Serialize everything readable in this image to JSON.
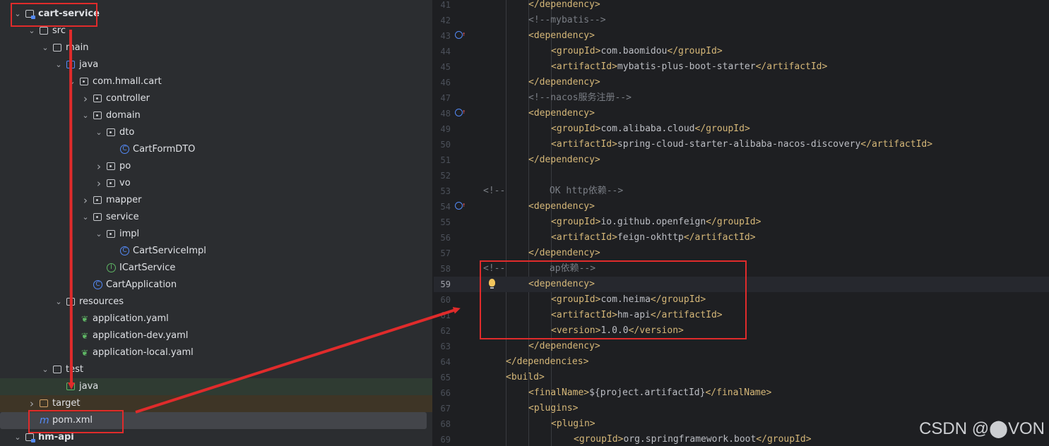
{
  "tree": {
    "items": [
      {
        "label": "cart-service",
        "type": "module",
        "expanded": true
      },
      {
        "label": "src",
        "type": "folder",
        "expanded": true
      },
      {
        "label": "main",
        "type": "folder",
        "expanded": true
      },
      {
        "label": "java",
        "type": "source-root",
        "expanded": true
      },
      {
        "label": "com.hmall.cart",
        "type": "package",
        "expanded": true
      },
      {
        "label": "controller",
        "type": "package",
        "expanded": false
      },
      {
        "label": "domain",
        "type": "package",
        "expanded": true
      },
      {
        "label": "dto",
        "type": "package",
        "expanded": true
      },
      {
        "label": "CartFormDTO",
        "type": "class"
      },
      {
        "label": "po",
        "type": "package",
        "expanded": false
      },
      {
        "label": "vo",
        "type": "package",
        "expanded": false
      },
      {
        "label": "mapper",
        "type": "package",
        "expanded": false
      },
      {
        "label": "service",
        "type": "package",
        "expanded": true
      },
      {
        "label": "impl",
        "type": "package",
        "expanded": true
      },
      {
        "label": "CartServiceImpl",
        "type": "class"
      },
      {
        "label": "ICartService",
        "type": "interface"
      },
      {
        "label": "CartApplication",
        "type": "spring-class"
      },
      {
        "label": "resources",
        "type": "resources-root",
        "expanded": true
      },
      {
        "label": "application.yaml",
        "type": "yaml"
      },
      {
        "label": "application-dev.yaml",
        "type": "yaml"
      },
      {
        "label": "application-local.yaml",
        "type": "yaml"
      },
      {
        "label": "test",
        "type": "folder",
        "expanded": true
      },
      {
        "label": "java",
        "type": "test-root"
      },
      {
        "label": "target",
        "type": "excluded",
        "expanded": false
      },
      {
        "label": "pom.xml",
        "type": "maven"
      },
      {
        "label": "hm-api",
        "type": "module",
        "expanded": true
      }
    ]
  },
  "editor": {
    "current_line": 59,
    "lines": [
      {
        "n": "41",
        "text": "</dependency>"
      },
      {
        "n": "42",
        "text": "<!--mybatis-->"
      },
      {
        "n": "43",
        "text": "<dependency>"
      },
      {
        "n": "44",
        "text": "<groupId>com.baomidou</groupId>"
      },
      {
        "n": "45",
        "text": "<artifactId>mybatis-plus-boot-starter</artifactId>"
      },
      {
        "n": "46",
        "text": "</dependency>"
      },
      {
        "n": "47",
        "text": "<!--nacos服务注册-->"
      },
      {
        "n": "48",
        "text": "<dependency>"
      },
      {
        "n": "49",
        "text": "<groupId>com.alibaba.cloud</groupId>"
      },
      {
        "n": "50",
        "text": "<artifactId>spring-cloud-starter-alibaba-nacos-discovery</artifactId>"
      },
      {
        "n": "51",
        "text": "</dependency>"
      },
      {
        "n": "52",
        "text": ""
      },
      {
        "n": "53",
        "text": "<!--        OK http依赖-->"
      },
      {
        "n": "54",
        "text": "<dependency>"
      },
      {
        "n": "55",
        "text": "<groupId>io.github.openfeign</groupId>"
      },
      {
        "n": "56",
        "text": "<artifactId>feign-okhttp</artifactId>"
      },
      {
        "n": "57",
        "text": "</dependency>"
      },
      {
        "n": "58",
        "text": "<!--        ap依赖-->"
      },
      {
        "n": "59",
        "text": "<dependency>"
      },
      {
        "n": "60",
        "text": "<groupId>com.heima</groupId>"
      },
      {
        "n": "61",
        "text": "<artifactId>hm-api</artifactId>"
      },
      {
        "n": "62",
        "text": "<version>1.0.0</version>"
      },
      {
        "n": "63",
        "text": "</dependency>"
      },
      {
        "n": "64",
        "text": "</dependencies>"
      },
      {
        "n": "65",
        "text": "<build>"
      },
      {
        "n": "66",
        "text": "<finalName>${project.artifactId}</finalName>"
      },
      {
        "n": "67",
        "text": "<plugins>"
      },
      {
        "n": "68",
        "text": "<plugin>"
      },
      {
        "n": "69",
        "text": "<groupId>org.springframework.boot</groupId>"
      }
    ]
  },
  "watermark": "CSDN @⬤VON",
  "colors": {
    "highlight_box": "#e02b2b",
    "tag": "#d5b778",
    "comment": "#7a7e85",
    "text": "#bcbec4"
  }
}
